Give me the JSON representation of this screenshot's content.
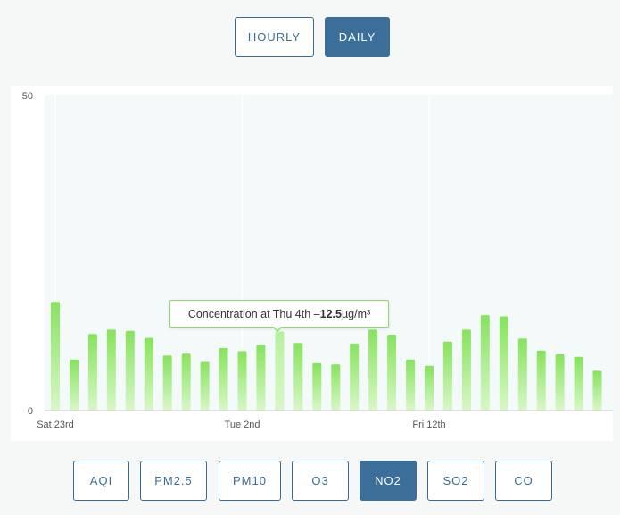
{
  "range_tabs": [
    {
      "label": "HOURLY",
      "active": false
    },
    {
      "label": "DAILY",
      "active": true
    }
  ],
  "pollutant_tabs": [
    {
      "label": "AQI",
      "active": false
    },
    {
      "label": "PM2.5",
      "active": false
    },
    {
      "label": "PM10",
      "active": false
    },
    {
      "label": "O3",
      "active": false
    },
    {
      "label": "NO2",
      "active": true
    },
    {
      "label": "SO2",
      "active": false
    },
    {
      "label": "CO",
      "active": false
    }
  ],
  "tooltip": {
    "prefix": "Concentration at Thu 4th – ",
    "value": "12.5",
    "unit": " µg/m³"
  },
  "colors": {
    "accent": "#3b6e99",
    "bar_top": "#86e35c",
    "bar_bottom": "#d8f7c8",
    "bar_highlight_top": "#b6f29a",
    "plot_bg": "#f3faf9"
  },
  "chart_data": {
    "type": "bar",
    "ylim": [
      0,
      50
    ],
    "y_ticks": [
      "0",
      "50"
    ],
    "x_tick_labels": [
      {
        "index": 0,
        "label": "Sat 23rd"
      },
      {
        "index": 10,
        "label": "Tue 2nd"
      },
      {
        "index": 20,
        "label": "Fri 12th"
      }
    ],
    "highlight_index": 12,
    "values": [
      17.2,
      8.1,
      12.1,
      12.8,
      12.6,
      11.5,
      8.7,
      9.0,
      7.7,
      9.9,
      9.4,
      10.4,
      12.5,
      10.7,
      7.5,
      7.3,
      10.6,
      12.8,
      12.0,
      8.1,
      7.1,
      10.9,
      12.8,
      15.1,
      14.9,
      11.4,
      9.5,
      8.9,
      8.5,
      6.3
    ]
  }
}
